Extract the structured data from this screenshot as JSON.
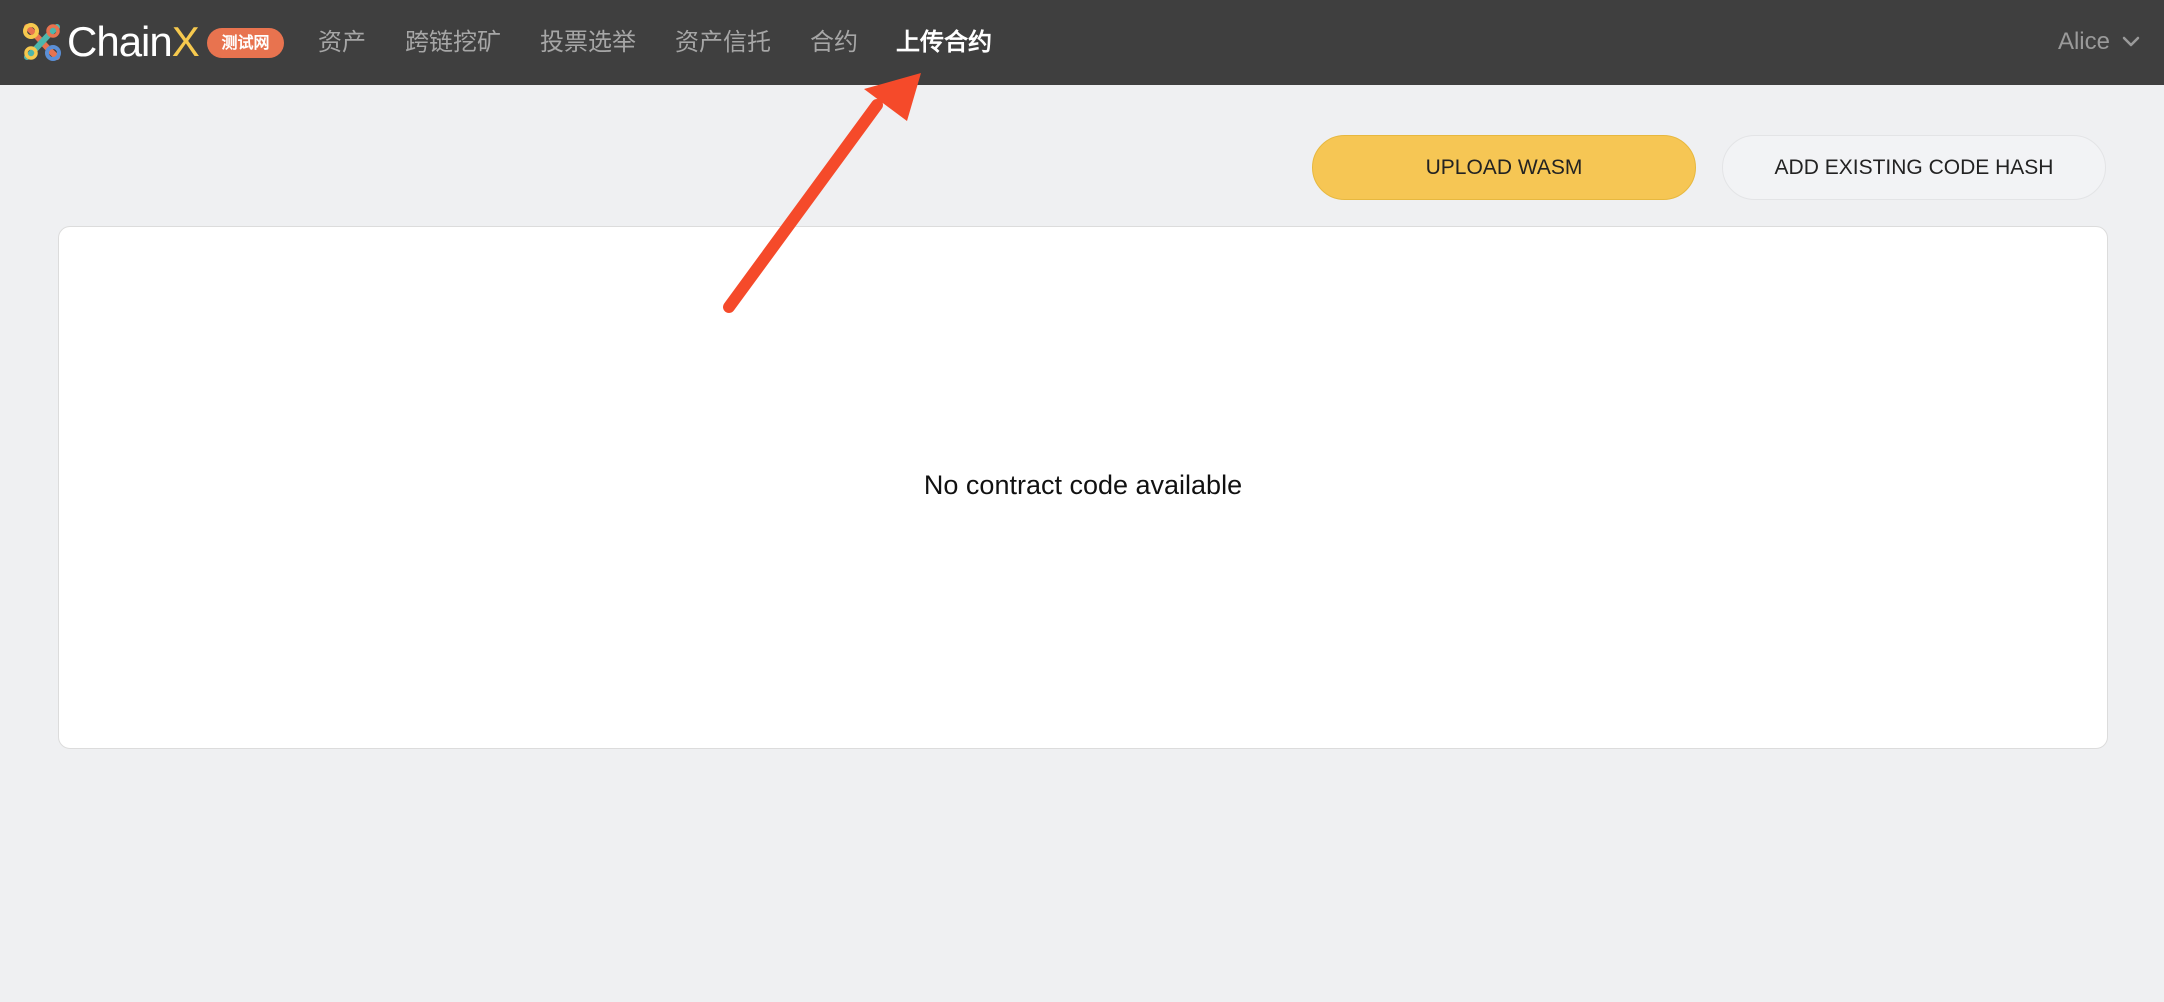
{
  "brand": {
    "name_part1": "Chain",
    "name_part2": "X",
    "network_badge": "测试网",
    "logo_icon": "chainx-logo-icon",
    "accent_color": "#f6c94e"
  },
  "nav": {
    "items": [
      {
        "label": "资产",
        "active": false
      },
      {
        "label": "跨链挖矿",
        "active": false
      },
      {
        "label": "投票选举",
        "active": false
      },
      {
        "label": "资产信托",
        "active": false
      },
      {
        "label": "合约",
        "active": false
      },
      {
        "label": "上传合约",
        "active": true
      }
    ]
  },
  "account": {
    "name": "Alice",
    "icon": "chevron-down-icon"
  },
  "actions": {
    "upload_wasm": "UPLOAD WASM",
    "add_code_hash": "ADD EXISTING CODE HASH"
  },
  "content": {
    "empty_message": "No contract code available"
  },
  "colors": {
    "topbar": "#3f3f3f",
    "primary_button": "#f6c654",
    "badge": "#e8734f",
    "annotation_arrow": "#f54a2a",
    "page_background": "#eff0f2"
  }
}
